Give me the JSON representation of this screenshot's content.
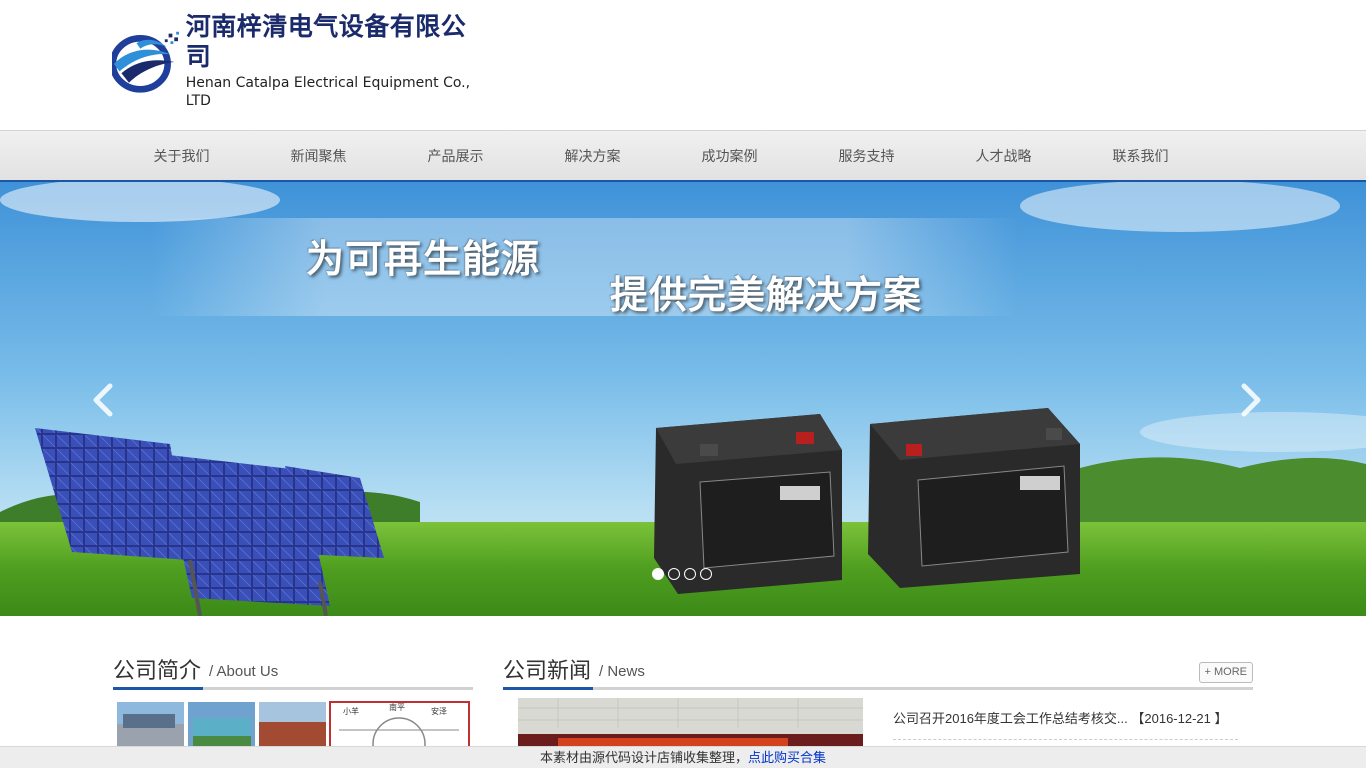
{
  "logo": {
    "name_cn": "河南梓清电气设备有限公司",
    "name_en": "Henan Catalpa Electrical Equipment Co., LTD",
    "mark_colors": [
      "#1f3f9a",
      "#2f8fd8",
      "#1b2a6b"
    ]
  },
  "nav": {
    "items": [
      "关于我们",
      "新闻聚焦",
      "产品展示",
      "解决方案",
      "成功案例",
      "服务支持",
      "人才战略",
      "联系我们"
    ]
  },
  "banner": {
    "slogan_line1": "为可再生能源",
    "slogan_line2": "提供完美解决方案",
    "prev_icon": "chevron-left-icon",
    "next_icon": "chevron-right-icon",
    "slide_count": 4,
    "active_slide": 1
  },
  "about": {
    "title": "公司简介",
    "subtitle": "/ About Us"
  },
  "news": {
    "title": "公司新闻",
    "subtitle": "/ News",
    "more_label": "+ MORE",
    "items": [
      {
        "text": "公司召开2016年度工会工作总结考核交...",
        "date": "【2016-12-21 】"
      }
    ]
  },
  "footer": {
    "text": "本素材由源代码设计店铺收集整理，",
    "link": "点此购买合集"
  },
  "colors": {
    "accent": "#1c57a5",
    "nav_bg": "#e6e6e6",
    "link": "#0033cc"
  }
}
